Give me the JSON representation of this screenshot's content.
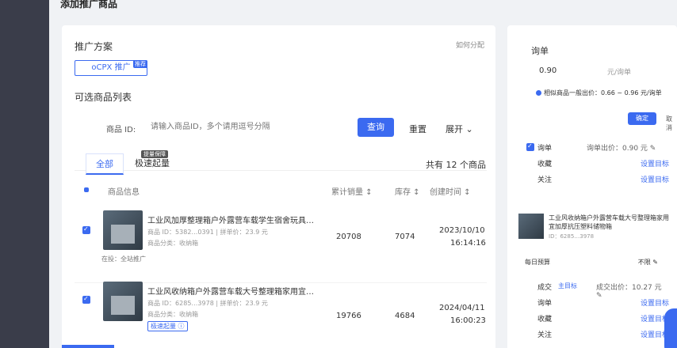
{
  "page": {
    "title": "添加推广商品"
  },
  "promo": {
    "title": "推广方案",
    "help": "如何分配",
    "ocpx_label": "oCPX 推广",
    "ocpx_tag": "推荐"
  },
  "list": {
    "title": "可选商品列表"
  },
  "search": {
    "label": "商品 ID:",
    "placeholder": "请输入商品ID，多个请用逗号分隔",
    "query": "查询",
    "reset": "重置",
    "expand": "展开 ⌄"
  },
  "tabs": {
    "all": "全部",
    "fast": "极速起量",
    "fast_tag": "提量保障"
  },
  "total": "共有 12 个商品",
  "table": {
    "headers": [
      "商品信息",
      "累计销量 ↕",
      "库存 ↕",
      "创建时间 ↕"
    ],
    "rows": [
      {
        "name": "工业风加厚整理箱户外露营车载学生宿舍玩具…",
        "meta1": "商品 ID：5382…0391 | 拼单价：23.9 元",
        "meta2": "商品分类：收纳箱",
        "status": "在投：全站推广",
        "sales": "20708",
        "stock": "7074",
        "date": "2023/10/10",
        "time": "16:14:16"
      },
      {
        "name": "工业风收纳箱户外露营车载大号整理箱家用宜…",
        "meta1": "商品 ID：6285…3978 | 拼单价：23.9 元",
        "meta2": "商品分类：收纳箱",
        "badge": "极速起量 ⓘ",
        "sales": "19766",
        "stock": "4684",
        "date": "2024/04/11",
        "time": "16:00:23"
      }
    ]
  },
  "right": {
    "title": "询单",
    "bid": "0.90",
    "unit": "元/询单",
    "hint": "相似商品一般出价：0.66 ~ 0.96 元/询单",
    "confirm": "确定",
    "cancel": "取消",
    "rows": [
      {
        "label": "询单",
        "mid": "询单出价：0.90 元 ✎",
        "right": ""
      },
      {
        "label": "收藏",
        "right": "设置目标"
      },
      {
        "label": "关注",
        "right": "设置目标"
      }
    ],
    "product_name": "工业风收纳箱户外露营车载大号整理箱家用宜加厚抗压塑料储物箱",
    "product_id": "ID：6285…3978",
    "budget_label": "每日预算",
    "budget_value": "不限 ✎",
    "rows2": [
      {
        "label": "成交",
        "mid": "成交出价：10.27 元 ✎",
        "tag": "主目标"
      },
      {
        "label": "询单",
        "right": "设置目标"
      },
      {
        "label": "收藏",
        "right": "设置目标"
      },
      {
        "label": "关注",
        "right": "设置目标"
      }
    ]
  }
}
